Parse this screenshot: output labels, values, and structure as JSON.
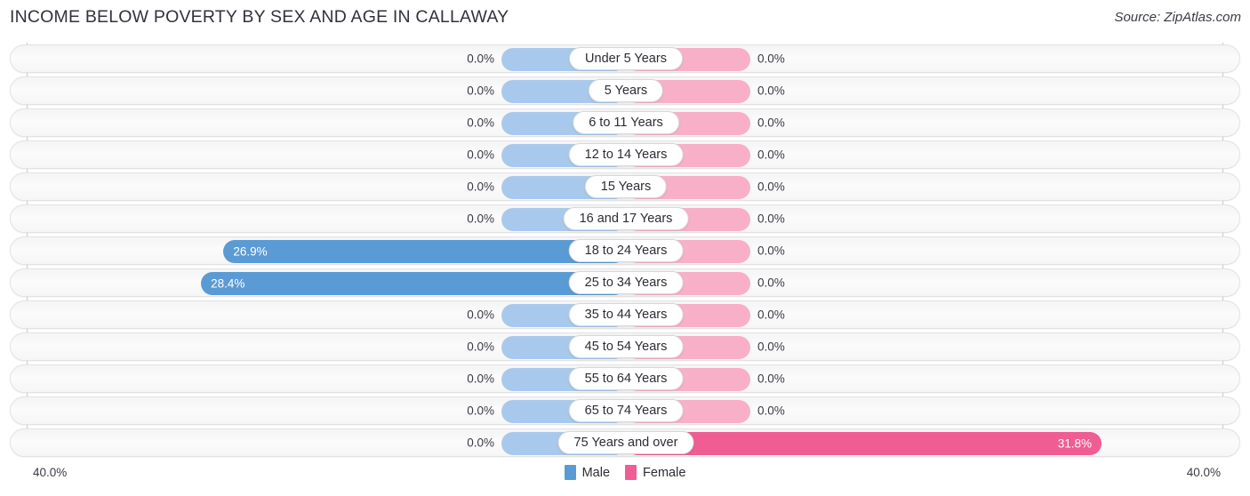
{
  "header": {
    "title": "INCOME BELOW POVERTY BY SEX AND AGE IN CALLAWAY",
    "source": "Source: ZipAtlas.com"
  },
  "axis": {
    "left_label": "40.0%",
    "right_label": "40.0%",
    "max": 40.0
  },
  "legend": {
    "items": [
      {
        "label": "Male",
        "color": "#5b9bd5"
      },
      {
        "label": "Female",
        "color": "#ef5d92"
      }
    ]
  },
  "colors": {
    "male": "#5b9bd5",
    "female": "#ef5d92",
    "male_zero": "#a9c9ec",
    "female_zero": "#f8b0c8",
    "row_border": "#e2e2e4",
    "axis_line": "#c9c9cf",
    "text": "#3a3a44"
  },
  "chart_data": {
    "type": "bar",
    "orientation": "horizontal-diverging",
    "title": "INCOME BELOW POVERTY BY SEX AND AGE IN CALLAWAY",
    "xlabel": "",
    "ylabel": "",
    "xlim": [
      -40.0,
      40.0
    ],
    "grid": false,
    "legend_position": "bottom-center",
    "categories": [
      "Under 5 Years",
      "5 Years",
      "6 to 11 Years",
      "12 to 14 Years",
      "15 Years",
      "16 and 17 Years",
      "18 to 24 Years",
      "25 to 34 Years",
      "35 to 44 Years",
      "45 to 54 Years",
      "55 to 64 Years",
      "65 to 74 Years",
      "75 Years and over"
    ],
    "series": [
      {
        "name": "Male",
        "values": [
          0.0,
          0.0,
          0.0,
          0.0,
          0.0,
          0.0,
          26.9,
          28.4,
          0.0,
          0.0,
          0.0,
          0.0,
          0.0
        ],
        "labels": [
          "0.0%",
          "0.0%",
          "0.0%",
          "0.0%",
          "0.0%",
          "0.0%",
          "26.9%",
          "28.4%",
          "0.0%",
          "0.0%",
          "0.0%",
          "0.0%",
          "0.0%"
        ]
      },
      {
        "name": "Female",
        "values": [
          0.0,
          0.0,
          0.0,
          0.0,
          0.0,
          0.0,
          0.0,
          0.0,
          0.0,
          0.0,
          0.0,
          0.0,
          31.8
        ],
        "labels": [
          "0.0%",
          "0.0%",
          "0.0%",
          "0.0%",
          "0.0%",
          "0.0%",
          "0.0%",
          "0.0%",
          "0.0%",
          "0.0%",
          "0.0%",
          "0.0%",
          "31.8%"
        ]
      }
    ]
  }
}
